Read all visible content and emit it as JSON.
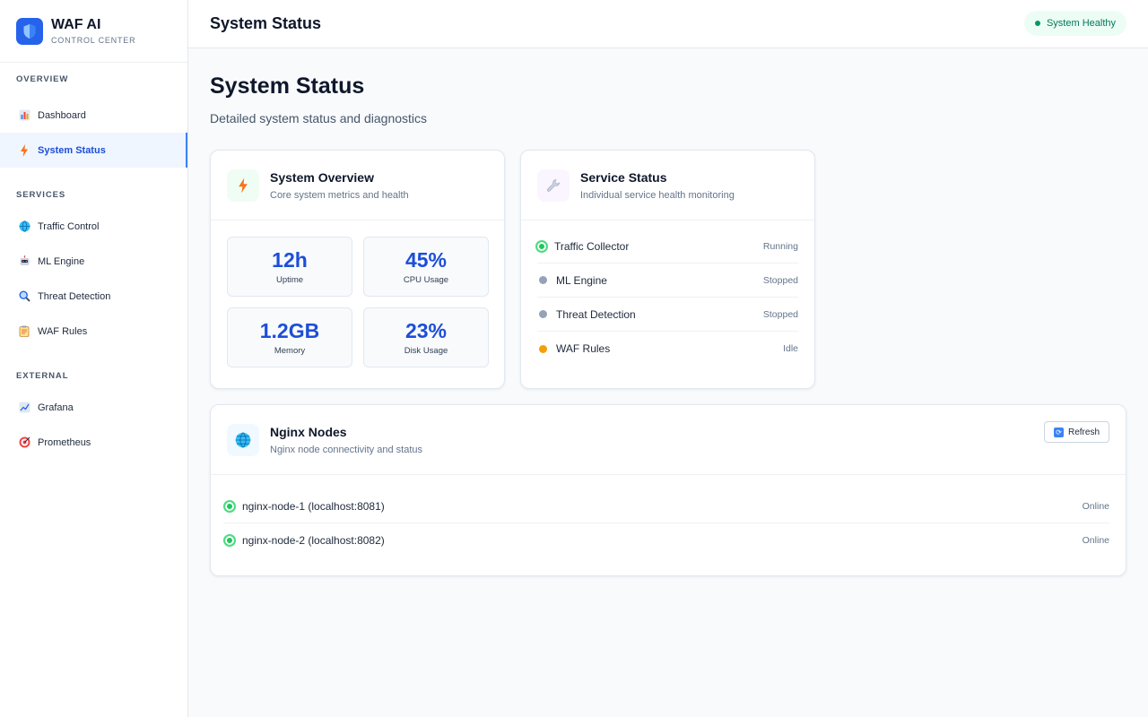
{
  "brand": {
    "title": "WAF AI",
    "subtitle": "CONTROL CENTER"
  },
  "sidebar": {
    "sections": [
      {
        "label": "OVERVIEW",
        "items": [
          {
            "label": "Dashboard",
            "icon": "bar-chart-icon"
          },
          {
            "label": "System Status",
            "icon": "lightning-icon",
            "active": true
          }
        ]
      },
      {
        "label": "SERVICES",
        "items": [
          {
            "label": "Traffic Control",
            "icon": "globe-icon"
          },
          {
            "label": "ML Engine",
            "icon": "robot-icon"
          },
          {
            "label": "Threat Detection",
            "icon": "magnifier-icon"
          },
          {
            "label": "WAF Rules",
            "icon": "clipboard-icon"
          }
        ]
      },
      {
        "label": "EXTERNAL",
        "items": [
          {
            "label": "Grafana",
            "icon": "trend-chart-icon"
          },
          {
            "label": "Prometheus",
            "icon": "target-icon"
          }
        ]
      }
    ]
  },
  "header": {
    "title": "System Status",
    "health_badge": "System Healthy"
  },
  "page": {
    "title": "System Status",
    "subtitle": "Detailed system status and diagnostics"
  },
  "overview_card": {
    "title": "System Overview",
    "subtitle": "Core system metrics and health",
    "metrics": [
      {
        "value": "12h",
        "label": "Uptime"
      },
      {
        "value": "45%",
        "label": "CPU Usage"
      },
      {
        "value": "1.2GB",
        "label": "Memory"
      },
      {
        "value": "23%",
        "label": "Disk Usage"
      }
    ]
  },
  "service_card": {
    "title": "Service Status",
    "subtitle": "Individual service health monitoring",
    "services": [
      {
        "name": "Traffic Collector",
        "status": "Running",
        "state": "running"
      },
      {
        "name": "ML Engine",
        "status": "Stopped",
        "state": "stopped"
      },
      {
        "name": "Threat Detection",
        "status": "Stopped",
        "state": "stopped"
      },
      {
        "name": "WAF Rules",
        "status": "Idle",
        "state": "idle"
      }
    ]
  },
  "nginx_card": {
    "title": "Nginx Nodes",
    "subtitle": "Nginx node connectivity and status",
    "refresh_label": "Refresh",
    "nodes": [
      {
        "name": "nginx-node-1 (localhost:8081)",
        "status": "Online"
      },
      {
        "name": "nginx-node-2 (localhost:8082)",
        "status": "Online"
      }
    ]
  },
  "colors": {
    "accent": "#2563eb",
    "active_bg": "#eff6ff",
    "healthy": "#059669",
    "running": "#22c55e",
    "stopped": "#94a3b8",
    "idle": "#f59e0b"
  }
}
